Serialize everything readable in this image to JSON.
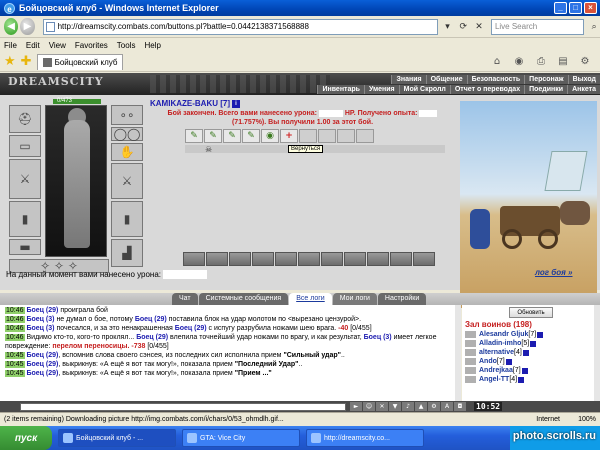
{
  "window": {
    "title": "Бойцовский клуб - Windows Internet Explorer",
    "minimize": "_",
    "maximize": "□",
    "close": "×"
  },
  "address": {
    "url": "http://dreamscity.combats.com/buttons.pl?battle=0.0442138371568888",
    "search_placeholder": "Live Search"
  },
  "menu": [
    "File",
    "Edit",
    "View",
    "Favorites",
    "Tools",
    "Help"
  ],
  "favorites": {
    "tab_label": "Бойцовский клуб"
  },
  "game": {
    "logo": "DREAMSCITY",
    "nav_top": [
      "Знания",
      "Общение",
      "Безопасность",
      "Персонаж",
      "Выход"
    ],
    "nav_sub": [
      "Инвентарь",
      "Умения",
      "Мой Скролл",
      "Отчет о переводах",
      "Поединки",
      "Анкета"
    ],
    "hp": "0/473",
    "character_name": "KAMIKAZE-BAKU [7]",
    "battle_message_line1": "Бой закончен. Всего вами нанесено урона:",
    "battle_message_hp": "HP. Получено опыта:",
    "battle_message_line2a": "(71.757%). Вы получили",
    "battle_message_reward": "1.00",
    "battle_message_line2b": "за этот бой.",
    "tooltip": "Вернуться",
    "damage_label": "На данный момент вами нанесено урона:",
    "log_link": "лог боя »",
    "stats": [
      "0",
      "0",
      "0",
      "0",
      "0",
      "0",
      "0"
    ]
  },
  "chat": {
    "tabs": [
      "Чат",
      "Системные сообщения",
      "Все логи",
      "Мои логи",
      "Настройки"
    ],
    "lines": [
      {
        "time": "10:46",
        "parts": [
          [
            "nick",
            "Боец (29)"
          ],
          [
            "text",
            " проиграла бой"
          ]
        ]
      },
      {
        "time": "10:46",
        "parts": [
          [
            "nick",
            "Боец (3)"
          ],
          [
            "text",
            " не думал о бое, потому "
          ],
          [
            "nick",
            "Боец (29)"
          ],
          [
            "text",
            " поставила блок на удар молотом по <вырезано цензурой>."
          ]
        ]
      },
      {
        "time": "10:46",
        "parts": [
          [
            "nick",
            "Боец (3)"
          ],
          [
            "text",
            " почесался, и за это ненакрашенная "
          ],
          [
            "nick",
            "Боец (29)"
          ],
          [
            "text",
            " с испугу разрубила ножами шею врага. "
          ],
          [
            "hit",
            "-40"
          ],
          [
            "text",
            " [0/455]"
          ]
        ]
      },
      {
        "time": "10:46",
        "parts": [
          [
            "text",
            "Видимо кто-то, кого-то проклял... "
          ],
          [
            "nick",
            "Боец (29)"
          ],
          [
            "text",
            " влепила точнейший удар ножами по врагу, и как результат, "
          ],
          [
            "nick",
            "Боец (3)"
          ],
          [
            "text",
            " имеет легкое повреждение: "
          ],
          [
            "hit",
            "перелом переносицы. -738"
          ],
          [
            "text",
            " [0/455]"
          ]
        ]
      },
      {
        "time": "10:45",
        "parts": [
          [
            "nick",
            "Боец (29)"
          ],
          [
            "text",
            ", вспомнив слова своего сэнсея, из последних сил исполнила прием "
          ],
          [
            "bold",
            "\"Сильный удар\""
          ],
          [
            "text",
            ".."
          ]
        ]
      },
      {
        "time": "10:45",
        "parts": [
          [
            "nick",
            "Боец (29)"
          ],
          [
            "text",
            ", выкрикнув: «А ещё я вот так могу!», показала прием "
          ],
          [
            "bold",
            "\"Последний Удар\""
          ],
          [
            "text",
            ".."
          ]
        ]
      },
      {
        "time": "10:45",
        "parts": [
          [
            "nick",
            "Боец (29)"
          ],
          [
            "text",
            ", выкрикнув: «А ещё я вот так могу!», показала прием "
          ],
          [
            "bold",
            "\"Прием ...\""
          ]
        ]
      }
    ]
  },
  "players": {
    "refresh": "Обновить",
    "title": "Зал воинов (198)",
    "list": [
      {
        "name": "Alesandr Gljuk",
        "level": "[7]"
      },
      {
        "name": "Alladin-imho",
        "level": "[5]"
      },
      {
        "name": "alternative",
        "level": "[4]"
      },
      {
        "name": "Ando",
        "level": "[7]"
      },
      {
        "name": "Andrejkaa",
        "level": "[7]"
      },
      {
        "name": "Angel-TT",
        "level": "[4]"
      }
    ]
  },
  "clock": "10:52",
  "status": {
    "text": "(2 items remaining) Downloading picture http://img.combats.com/i/chars/0/53_ohmdlh.gif...",
    "zone": "Internet",
    "zoom": "100%"
  },
  "taskbar": {
    "start": "пуск",
    "tasks": [
      "Бойцовский клуб - ...",
      "GTA: Vice City",
      "http://dreamscity.co..."
    ]
  },
  "watermark": "photo.scrolls.ru"
}
